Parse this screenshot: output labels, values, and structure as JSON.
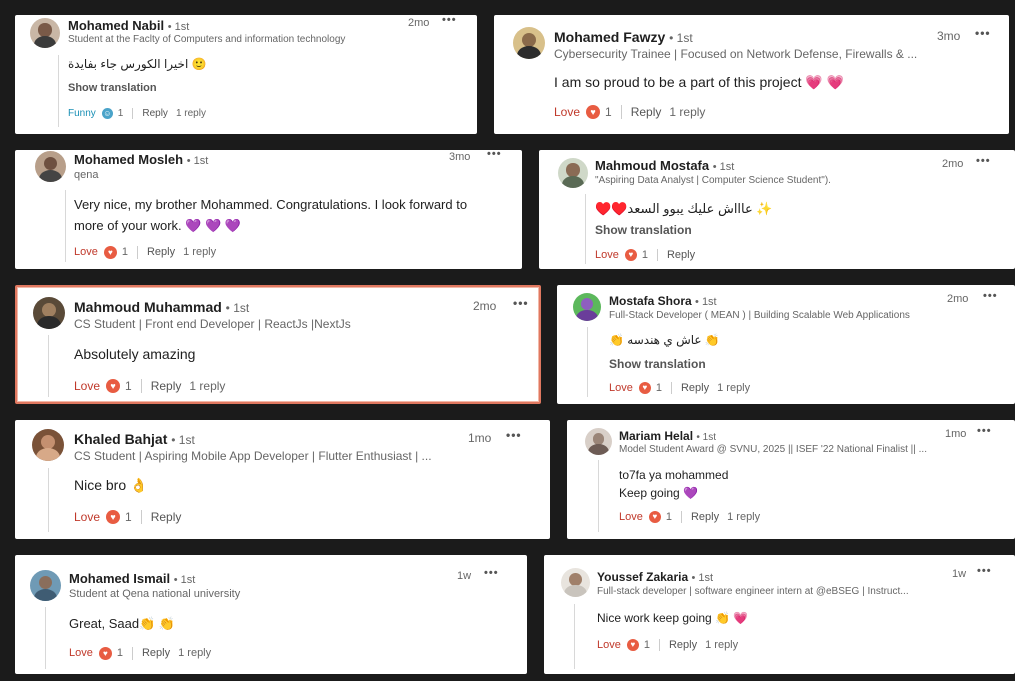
{
  "comments": [
    {
      "name": "Mohamed Nabil",
      "degree": "• 1st",
      "subtitle": "Student at the Faclty of Computers and information technology",
      "time": "2mo",
      "message": "اخيرا الكورس جاء بفايدة",
      "translation": "Show translation",
      "reaction": "Funny",
      "reaction_count": "1",
      "reply": "Reply",
      "reply_count": "1 reply",
      "emoji_prefix": "🙂"
    },
    {
      "name": "Mohamed Fawzy",
      "degree": "• 1st",
      "subtitle": "Cybersecurity Trainee | Focused on Network Defense, Firewalls & ...",
      "time": "3mo",
      "message": "I am so proud to be a part of this project 💗 💗",
      "reaction": "Love",
      "reaction_count": "1",
      "reply": "Reply",
      "reply_count": "1 reply"
    },
    {
      "name": "Mohamed Mosleh",
      "degree": "• 1st",
      "subtitle": "qena",
      "time": "3mo",
      "message_line1": "Very nice, my brother Mohammed. Congratulations. I look forward to",
      "message_line2": "more of your work. 💜 💜 💜",
      "reaction": "Love",
      "reaction_count": "1",
      "reply": "Reply",
      "reply_count": "1 reply"
    },
    {
      "name": "Mahmoud Mostafa",
      "degree": "• 1st",
      "subtitle": "\"Aspiring Data Analyst | Computer Science Student\").",
      "time": "2mo",
      "message": "✨ عاااش عليك يبوو السعد♥️♥️",
      "translation": "Show translation",
      "reaction": "Love",
      "reaction_count": "1",
      "reply": "Reply"
    },
    {
      "name": "Mahmoud Muhammad",
      "degree": "• 1st",
      "subtitle": "CS Student | Front end Developer | ReactJs |NextJs",
      "time": "2mo",
      "message": "Absolutely amazing",
      "reaction": "Love",
      "reaction_count": "1",
      "reply": "Reply",
      "reply_count": "1 reply"
    },
    {
      "name": "Mostafa Shora",
      "degree": "• 1st",
      "subtitle": "Full-Stack Developer ( MEAN ) | Building Scalable Web Applications",
      "time": "2mo",
      "message": "👏 عاش ي هندسه 👏",
      "translation": "Show translation",
      "reaction": "Love",
      "reaction_count": "1",
      "reply": "Reply",
      "reply_count": "1 reply"
    },
    {
      "name": "Khaled Bahjat",
      "degree": "• 1st",
      "subtitle": "CS Student | Aspiring Mobile App Developer | Flutter Enthusiast | ...",
      "time": "1mo",
      "message": "Nice bro 👌",
      "reaction": "Love",
      "reaction_count": "1",
      "reply": "Reply"
    },
    {
      "name": "Mariam Helal",
      "degree": "• 1st",
      "subtitle": "Model Student Award @ SVNU, 2025 || ISEF '22 National Finalist || ...",
      "time": "1mo",
      "message_line1": "to7fa ya mohammed",
      "message_line2": "Keep going 💜",
      "reaction": "Love",
      "reaction_count": "1",
      "reply": "Reply",
      "reply_count": "1 reply"
    },
    {
      "name": "Mohamed Ismail",
      "degree": "• 1st",
      "subtitle": "Student at Qena national university",
      "time": "1w",
      "message": "Great, Saad👏 👏",
      "reaction": "Love",
      "reaction_count": "1",
      "reply": "Reply",
      "reply_count": "1 reply"
    },
    {
      "name": "Youssef Zakaria",
      "degree": "• 1st",
      "subtitle": "Full-stack developer | software engineer intern at @eBSEG | Instruct...",
      "time": "1w",
      "message": "Nice work keep going 👏 💗",
      "reaction": "Love",
      "reaction_count": "1",
      "reply": "Reply",
      "reply_count": "1 reply"
    }
  ],
  "more_icon": "•••",
  "colors": {
    "background": "#1b1b1b",
    "love": "#c0392b",
    "funny": "#1a8fb5",
    "heart_badge": "#e85c42",
    "highlight_border": "#e07860"
  }
}
